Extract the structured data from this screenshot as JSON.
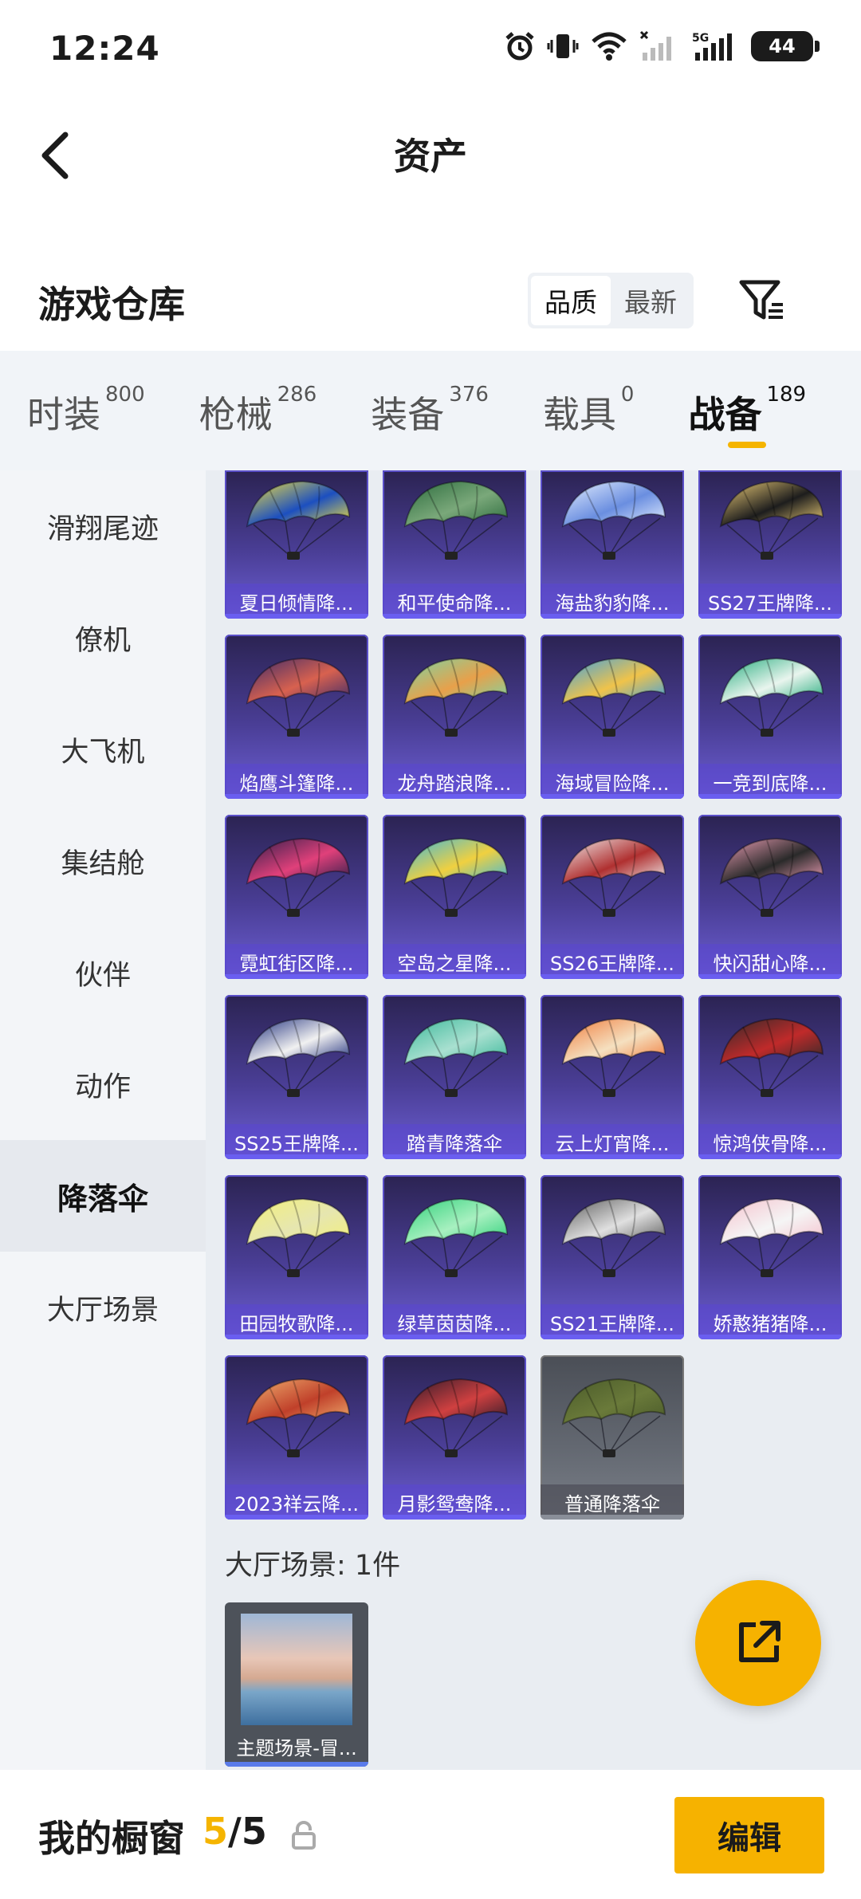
{
  "status_bar": {
    "time": "12:24",
    "battery": "44"
  },
  "header": {
    "title": "资产"
  },
  "section": {
    "title": "游戏仓库",
    "sort_options": [
      "品质",
      "最新"
    ],
    "active_sort": "品质"
  },
  "tabs": [
    {
      "label": "时装",
      "count": "800"
    },
    {
      "label": "枪械",
      "count": "286"
    },
    {
      "label": "装备",
      "count": "376"
    },
    {
      "label": "载具",
      "count": "0"
    },
    {
      "label": "战备",
      "count": "189"
    }
  ],
  "active_tab": "战备",
  "sidebar": {
    "items": [
      "滑翔尾迹",
      "僚机",
      "大飞机",
      "集结舱",
      "伙伴",
      "动作",
      "降落伞",
      "大厅场景"
    ],
    "active": "降落伞"
  },
  "items": [
    {
      "name": "夏日倾情降...",
      "colors": [
        "#f4e23c",
        "#1c4fc0"
      ]
    },
    {
      "name": "和平使命降...",
      "colors": [
        "#2a6a3c",
        "#7aa87a"
      ]
    },
    {
      "name": "海盐豹豹降...",
      "colors": [
        "#e7f0ff",
        "#6a8ee0"
      ]
    },
    {
      "name": "SS27王牌降...",
      "colors": [
        "#f2d17a",
        "#1d1d1d"
      ]
    },
    {
      "name": "焰鹰斗篷降...",
      "colors": [
        "#3a2a6a",
        "#d8614f"
      ]
    },
    {
      "name": "龙舟踏浪降...",
      "colors": [
        "#7ad6a6",
        "#e8a04a"
      ]
    },
    {
      "name": "海域冒险降...",
      "colors": [
        "#3aa0e6",
        "#f0c34a"
      ]
    },
    {
      "name": "一竞到底降...",
      "colors": [
        "#1fa97a",
        "#e9f5ee"
      ]
    },
    {
      "name": "霓虹街区降...",
      "colors": [
        "#2b1e4a",
        "#e0407a"
      ]
    },
    {
      "name": "空岛之星降...",
      "colors": [
        "#3ab8e0",
        "#f0d040"
      ]
    },
    {
      "name": "SS26王牌降...",
      "colors": [
        "#f1f1f1",
        "#b03030"
      ]
    },
    {
      "name": "快闪甜心降...",
      "colors": [
        "#f0a0b8",
        "#2a2a2a"
      ]
    },
    {
      "name": "SS25王牌降...",
      "colors": [
        "#1a2a7a",
        "#f1f1f1"
      ]
    },
    {
      "name": "踏青降落伞",
      "colors": [
        "#3ab89a",
        "#a9e0d0"
      ]
    },
    {
      "name": "云上灯宵降...",
      "colors": [
        "#f07a3a",
        "#f5e0c0"
      ]
    },
    {
      "name": "惊鸿侠骨降...",
      "colors": [
        "#2a2a2a",
        "#c02a2a"
      ]
    },
    {
      "name": "田园牧歌降...",
      "colors": [
        "#f3f07a",
        "#e6e6b0"
      ]
    },
    {
      "name": "绿草茵茵降...",
      "colors": [
        "#2ed07a",
        "#a8f0c0"
      ]
    },
    {
      "name": "SS21王牌降...",
      "colors": [
        "#5a5a5a",
        "#e0e0e0"
      ]
    },
    {
      "name": "娇憨猪猪降...",
      "colors": [
        "#f5c0cc",
        "#f5f5f5"
      ]
    },
    {
      "name": "2023祥云降...",
      "colors": [
        "#f0b070",
        "#c0402a"
      ]
    },
    {
      "name": "月影鸳鸯降...",
      "colors": [
        "#2a1a2a",
        "#d04040"
      ]
    },
    {
      "name": "普通降落伞",
      "colors": [
        "#4a5a2a",
        "#6a7a3a"
      ],
      "style": "gray"
    }
  ],
  "lobby": {
    "title": "大厅场景: 1件",
    "item": "主题场景-冒..."
  },
  "bottom": {
    "label": "我的橱窗",
    "count_current": "5",
    "count_sep": "/",
    "count_total": "5",
    "edit": "编辑"
  },
  "icons": {
    "back": "back-arrow-icon",
    "filter": "filter-icon",
    "share": "share-external-icon",
    "lock": "lock-icon"
  },
  "accent": "#f6b200"
}
